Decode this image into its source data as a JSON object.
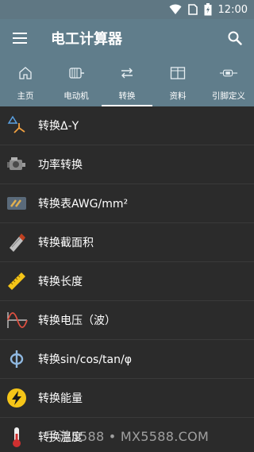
{
  "status_bar": {
    "time": "12:00",
    "icons": [
      "wifi-icon",
      "sim-icon",
      "battery-icon"
    ]
  },
  "app_bar": {
    "title": "电工计算器",
    "menu_icon": "hamburger-menu-icon",
    "search_icon": "search-icon"
  },
  "tabs": [
    {
      "label": "主页",
      "icon": "home-icon",
      "active": false
    },
    {
      "label": "电动机",
      "icon": "motor-icon",
      "active": false
    },
    {
      "label": "转换",
      "icon": "convert-icon",
      "active": true
    },
    {
      "label": "资料",
      "icon": "book-icon",
      "active": false
    },
    {
      "label": "引脚定义",
      "icon": "connector-icon",
      "active": false
    }
  ],
  "list": [
    {
      "label": "转换Δ-Y",
      "icon": "delta-star-icon"
    },
    {
      "label": "功率转换",
      "icon": "engine-icon"
    },
    {
      "label": "转换表AWG/mm²",
      "icon": "wire-gauge-icon"
    },
    {
      "label": "转换截面积",
      "icon": "cable-cross-section-icon"
    },
    {
      "label": "转换长度",
      "icon": "ruler-icon"
    },
    {
      "label": "转换电压（波）",
      "icon": "sine-wave-icon"
    },
    {
      "label": "转换sin/cos/tan/φ",
      "icon": "phi-icon"
    },
    {
      "label": "转换能量",
      "icon": "lightning-icon"
    },
    {
      "label": "转换温度",
      "icon": "thermometer-icon"
    }
  ],
  "watermark": "手游5588 • MX5588.COM",
  "colors": {
    "primary": "#607d8b",
    "background": "#2b2b2b",
    "accent_yellow": "#f5c518"
  }
}
